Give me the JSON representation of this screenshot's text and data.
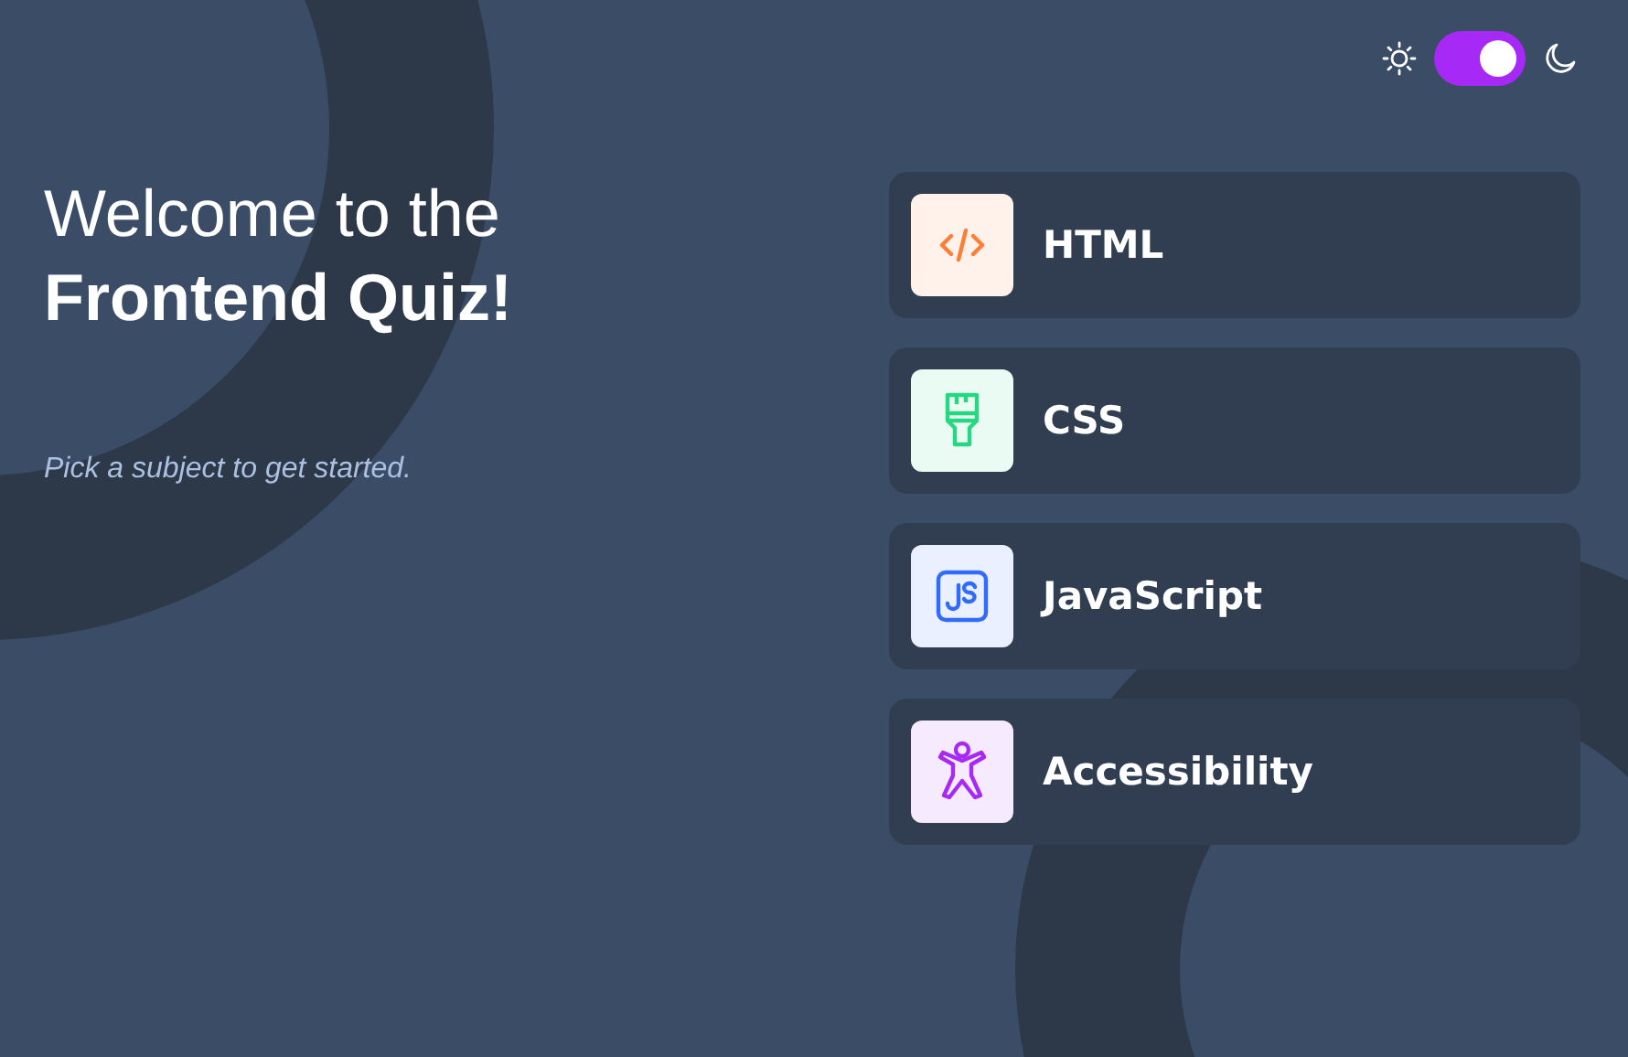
{
  "theme_toggle": {
    "on": true
  },
  "heading": {
    "line_1": "Welcome to the",
    "line_2": "Frontend Quiz!"
  },
  "subtitle": "Pick a subject to get started.",
  "subjects": [
    {
      "kind": "html",
      "label": "HTML",
      "color": "#ff7e35"
    },
    {
      "kind": "css",
      "label": "CSS",
      "color": "#26d782"
    },
    {
      "kind": "javascript",
      "label": "JavaScript",
      "color": "#306aff"
    },
    {
      "kind": "accessibility",
      "label": "Accessibility",
      "color": "#a729f5"
    }
  ]
}
